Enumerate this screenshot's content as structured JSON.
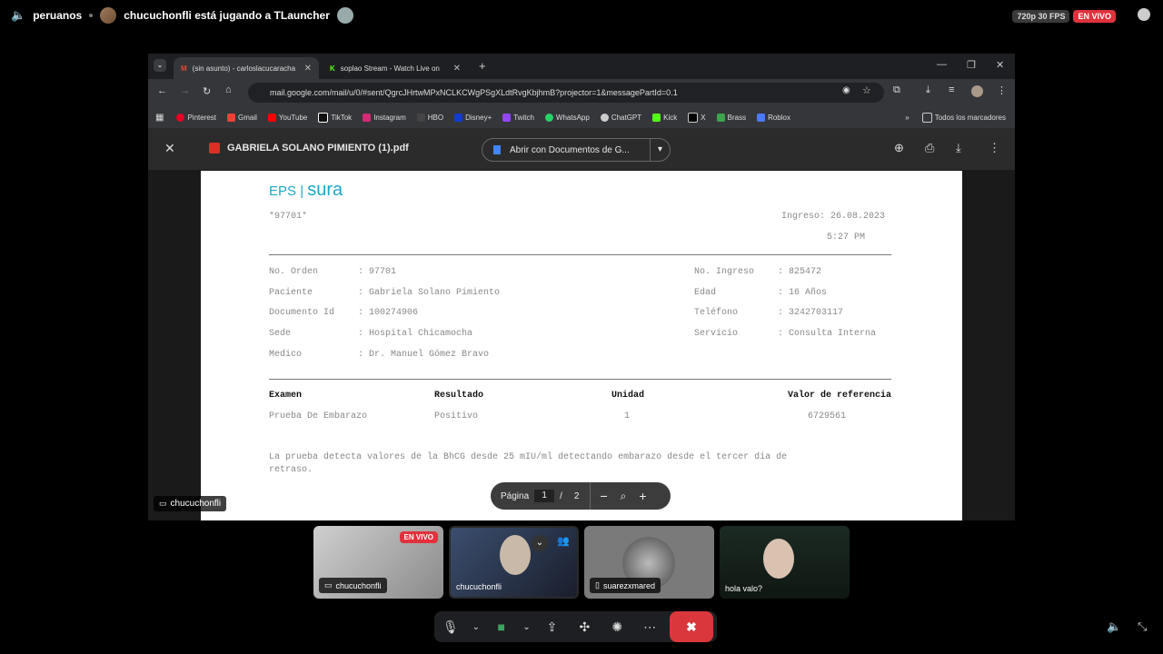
{
  "topbar": {
    "channel": "peruanos",
    "status": "chucuchonfli está jugando a TLauncher",
    "quality": "720p 30 FPS",
    "live": "EN VIVO"
  },
  "browser": {
    "tabs": [
      {
        "label": "(sin asunto) - carloslacucaracha"
      },
      {
        "label": "soplao Stream - Watch Live on"
      }
    ],
    "url": "mail.google.com/mail/u/0/#sent/QgrcJHrtwMPxNCLKCWgPSgXLdtRvgKbjhmB?projector=1&messagePartId=0.1",
    "bookmarks": [
      "Pinterest",
      "Gmail",
      "YouTube",
      "TikTok",
      "Instagram",
      "HBO",
      "Disney+",
      "Twitch",
      "WhatsApp",
      "ChatGPT",
      "Kick",
      "X",
      "Brass",
      "Roblox"
    ],
    "all_bookmarks": "Todos los marcadores"
  },
  "pdf": {
    "filename": "GABRIELA SOLANO PIMIENTO (1).pdf",
    "open_with": "Abrir con Documentos de G...",
    "page_label": "Página",
    "page_current": "1",
    "page_sep": "/",
    "page_total": "2"
  },
  "document": {
    "logo_eps": "EPS",
    "logo_sura": "sura",
    "code": "*97701*",
    "ingreso": "Ingreso: 26.08.2023",
    "time": "5:27 PM",
    "left_fields": [
      {
        "label": "No. Orden",
        "value": ": 97701"
      },
      {
        "label": "Paciente",
        "value": ": Gabriela Solano Pimiento"
      },
      {
        "label": "Documento Id",
        "value": ": 100274906"
      },
      {
        "label": "Sede",
        "value": ": Hospital Chicamocha"
      },
      {
        "label": "Medico",
        "value": ": Dr. Manuel Gómez Bravo"
      }
    ],
    "right_fields": [
      {
        "label": "No. Ingreso",
        "value": ": 825472"
      },
      {
        "label": "Edad",
        "value": ": 16 Años"
      },
      {
        "label": "Teléfono",
        "value": ": 3242703117"
      },
      {
        "label": "Servicio",
        "value": ": Consulta Interna"
      }
    ],
    "table_headers": [
      "Examen",
      "Resultado",
      "Unidad",
      "Valor de referencia"
    ],
    "table_row": [
      "Prueba De Embarazo",
      "Positivo",
      "1",
      "6729561"
    ],
    "note_line1": "La prueba detecta valores de la BhCG desde 25 mIU/ml detectando embarazo desde el tercer día de",
    "note_line2": "retraso."
  },
  "stream_owner": "chucuchonfli",
  "participants": [
    {
      "name": "chucuchonfli",
      "live": "EN VIVO"
    },
    {
      "name": "chucuchonfli"
    },
    {
      "name": "suarezxmared"
    },
    {
      "name": "hola valo?"
    }
  ],
  "colors": {
    "live_red": "#e0323c",
    "sura_blue": "#1ea7c5",
    "hangup_red": "#da373c"
  }
}
